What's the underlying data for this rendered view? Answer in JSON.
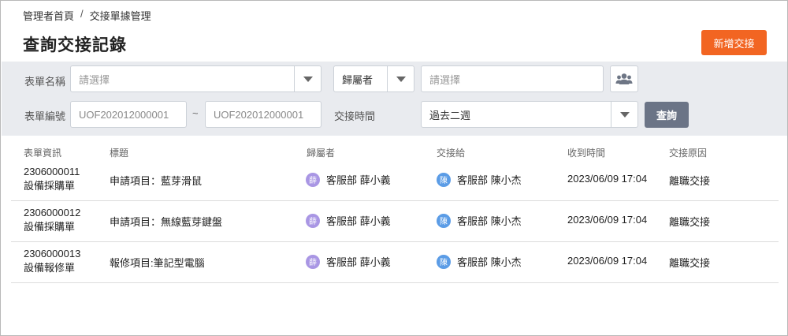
{
  "breadcrumb": {
    "home": "管理者首頁",
    "separator": "/",
    "current": "交接單據管理"
  },
  "page": {
    "title": "查詢交接記錄",
    "add_button": "新增交接"
  },
  "filters": {
    "form_name_label": "表單名稱",
    "form_name_placeholder": "請選擇",
    "owner_type_value": "歸屬者",
    "owner_placeholder": "請選擇",
    "form_no_label": "表單編號",
    "form_no_from": "UOF202012000001",
    "range_separator": "~",
    "form_no_to": "UOF202012000001",
    "handover_time_label": "交接時間",
    "handover_time_value": "過去二週",
    "query_button": "查詢"
  },
  "table": {
    "headers": {
      "doc_info": "表單資訊",
      "subject": "標題",
      "owner": "歸屬者",
      "handover_to": "交接給",
      "received_time": "收到時間",
      "reason": "交接原因"
    },
    "rows": [
      {
        "doc_no": "2306000011",
        "doc_type": "設備採購單",
        "subject": "申請項目：藍芽滑鼠",
        "owner_avatar": "薛",
        "owner": "客服部 薛小義",
        "to_avatar": "陳",
        "to": "客服部 陳小杰",
        "time": "2023/06/09 17:04",
        "reason": "離職交接"
      },
      {
        "doc_no": "2306000012",
        "doc_type": "設備採購單",
        "subject": "申請項目：無線藍芽鍵盤",
        "owner_avatar": "薛",
        "owner": "客服部 薛小義",
        "to_avatar": "陳",
        "to": "客服部 陳小杰",
        "time": "2023/06/09 17:04",
        "reason": "離職交接"
      },
      {
        "doc_no": "2306000013",
        "doc_type": "設備報修單",
        "subject": "報修項目:筆記型電腦",
        "owner_avatar": "薛",
        "owner": "客服部 薛小義",
        "to_avatar": "陳",
        "to": "客服部 陳小杰",
        "time": "2023/06/09 17:04",
        "reason": "離職交接"
      }
    ]
  },
  "colors": {
    "accent": "#f26522",
    "query_button": "#6b7486",
    "filter_bg": "#e9ebef",
    "owner_avatar": "#a996e4",
    "handover_avatar": "#5b9ce6"
  },
  "icons": {
    "dropdown": "chevron-down-icon",
    "people_picker": "people-group-icon"
  }
}
